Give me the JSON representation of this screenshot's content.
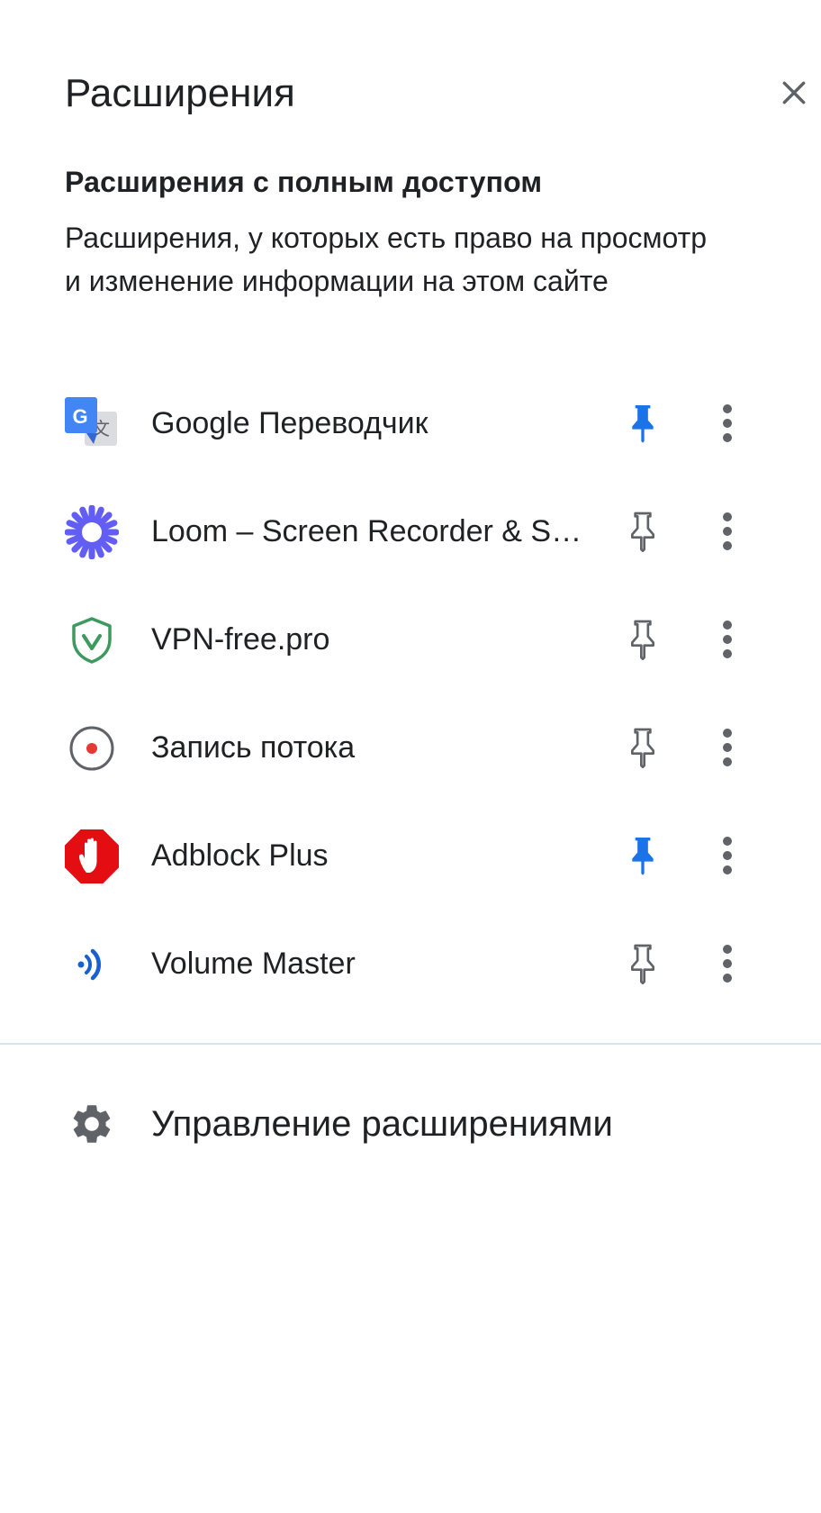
{
  "header": {
    "title": "Расширения",
    "close_icon": "close-icon"
  },
  "section": {
    "heading": "Расширения с полным доступом",
    "description": "Расширения, у которых есть право на просмотр и изменение информации на этом сайте"
  },
  "extensions": [
    {
      "name": "Google Переводчик",
      "icon": "google-translate-icon",
      "pinned": true
    },
    {
      "name": "Loom – Screen Recorder & Screen Capture",
      "icon": "loom-icon",
      "pinned": false
    },
    {
      "name": "VPN-free.pro",
      "icon": "vpn-shield-icon",
      "pinned": false
    },
    {
      "name": "Запись потока",
      "icon": "record-icon",
      "pinned": false
    },
    {
      "name": "Adblock Plus",
      "icon": "adblock-plus-icon",
      "pinned": true
    },
    {
      "name": "Volume Master",
      "icon": "volume-master-icon",
      "pinned": false
    }
  ],
  "footer": {
    "manage_label": "Управление расширениями",
    "manage_icon": "gear-icon"
  },
  "colors": {
    "pin_active": "#1a73e8",
    "pin_inactive": "#5f6368",
    "divider": "#d3e3f4"
  }
}
